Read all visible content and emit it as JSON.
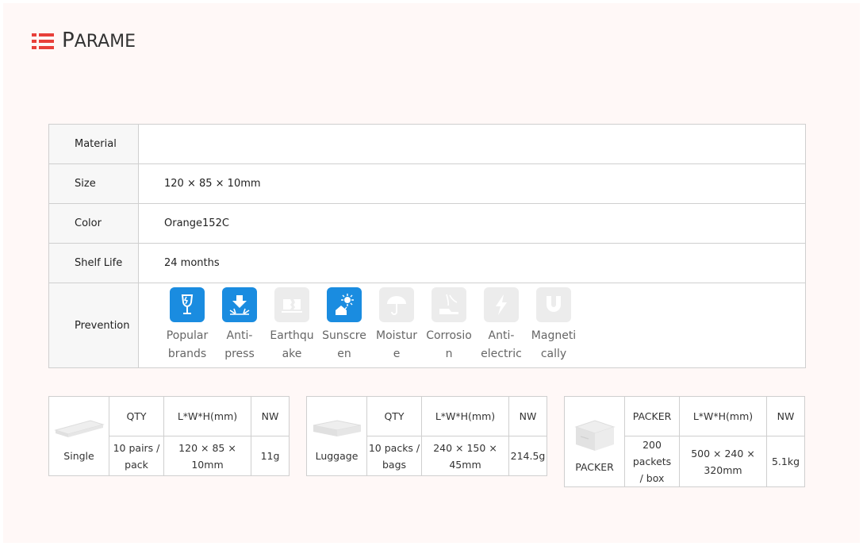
{
  "header": {
    "title_cap": "P",
    "title_rest": "ARAMET"
  },
  "params": {
    "rows": [
      {
        "label": "Material",
        "value": ""
      },
      {
        "label": "Size",
        "value": "120 × 85 × 10mm"
      },
      {
        "label": "Color",
        "value": "Orange152C"
      },
      {
        "label": "Shelf Life",
        "value": "24 months"
      }
    ],
    "prevention_label": "Prevention",
    "prevention_items": [
      {
        "line1": "Popular",
        "line2": "brands",
        "icon": "fragile-glass-icon",
        "active": true
      },
      {
        "line1": "Anti-",
        "line2": "press",
        "icon": "anti-press-icon",
        "active": true
      },
      {
        "line1": "Earthqu",
        "line2": "ake",
        "icon": "earthquake-icon",
        "active": false
      },
      {
        "line1": "Sunscre",
        "line2": "en",
        "icon": "sunscreen-icon",
        "active": true
      },
      {
        "line1": "Moistur",
        "line2": "e",
        "icon": "umbrella-icon",
        "active": false
      },
      {
        "line1": "Corrosio",
        "line2": "n",
        "icon": "corrosion-icon",
        "active": false
      },
      {
        "line1": "Anti-",
        "line2": "electric",
        "icon": "lightning-icon",
        "active": false
      },
      {
        "line1": "Magneti",
        "line2": "cally",
        "icon": "magnet-icon",
        "active": false
      }
    ]
  },
  "packaging": [
    {
      "name": "Single",
      "col1": "QTY",
      "col2": "L*W*H(mm)",
      "col3": "NW",
      "qty_line1": "10 pairs /",
      "qty_line2": "pack",
      "dim_line1": "120 × 85 × 10mm",
      "dim_line2": "",
      "nw": "11g",
      "icon": "flat-bar-icon"
    },
    {
      "name": "Luggage",
      "col1": "QTY",
      "col2": "L*W*H(mm)",
      "col3": "NW",
      "qty_line1": "10 packs /",
      "qty_line2": "bags",
      "dim_line1": "240 × 150 ×",
      "dim_line2": "45mm",
      "nw": "214.5g",
      "icon": "flat-box-icon"
    },
    {
      "name": "PACKER",
      "col1": "PACKER",
      "col2": "L*W*H(mm)",
      "col3": "NW",
      "qty_line1": "200 packets",
      "qty_line2": "/ box",
      "dim_line1": "500 × 240 ×",
      "dim_line2": "320mm",
      "nw": "5.1kg",
      "icon": "carton-box-icon"
    }
  ],
  "colors": {
    "accent": "#e8403a",
    "icon_active": "#1a8ce0",
    "icon_inactive": "#ececec",
    "border": "#cfcfcf"
  }
}
